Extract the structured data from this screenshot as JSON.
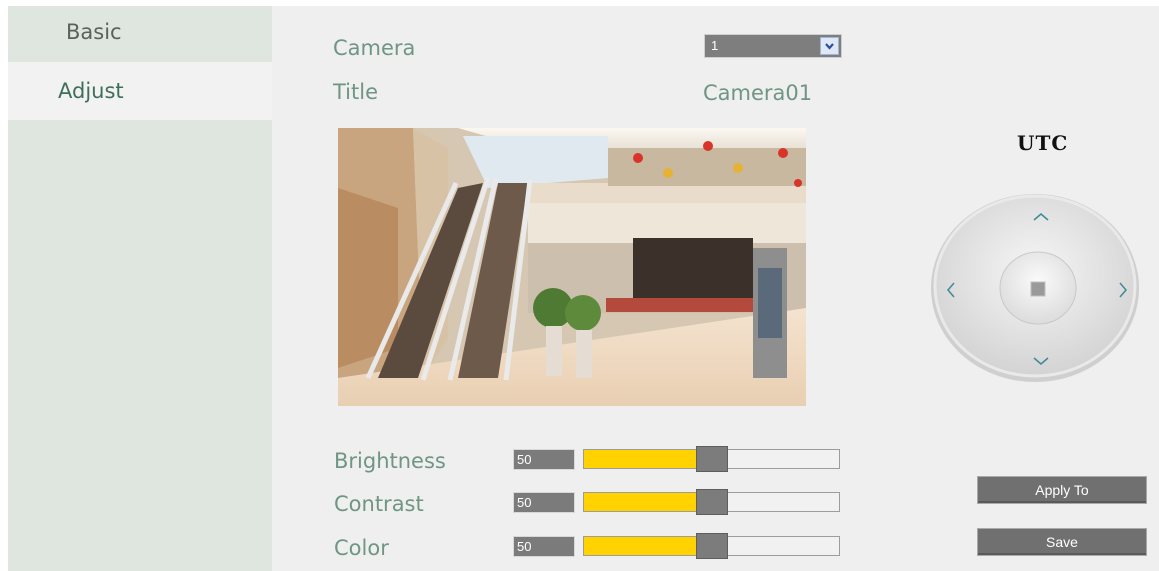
{
  "sidebar": {
    "items": [
      {
        "label": "Basic"
      },
      {
        "label": "Adjust"
      }
    ]
  },
  "settings": {
    "camera_label": "Camera",
    "camera_value": "1",
    "title_label": "Title",
    "title_value": "Camera01"
  },
  "ptz": {
    "timezone_label": "UTC"
  },
  "sliders": [
    {
      "label": "Brightness",
      "value": "50",
      "level": 0.5
    },
    {
      "label": "Contrast",
      "value": "50",
      "level": 0.5
    },
    {
      "label": "Color",
      "value": "50",
      "level": 0.5
    }
  ],
  "buttons": {
    "apply_label": "Apply To",
    "save_label": "Save"
  },
  "colors": {
    "slider_fill": "#ffd200",
    "text_accent": "#6f9584"
  }
}
